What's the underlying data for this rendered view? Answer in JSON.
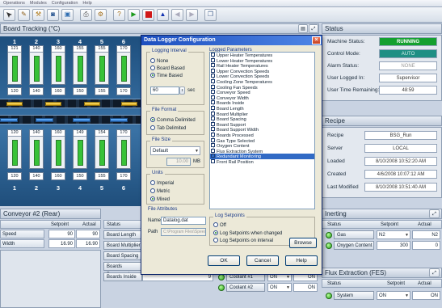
{
  "menubar": [
    "Operations",
    "Modules",
    "Configuration",
    "Help"
  ],
  "toolbar_icons": [
    "arrow-icon",
    "wrench-icon",
    "tool-icon",
    "camera-icon",
    "screen-icon",
    "printer-icon",
    "gear-icon",
    "help-icon",
    "play-icon",
    "stop-icon",
    "triangle-icon",
    "nav-icon",
    "nav2-icon",
    "window-icon"
  ],
  "board_tracking": {
    "title": "Board Tracking (°C)",
    "columns": [
      "1",
      "2",
      "3",
      "4",
      "5",
      "6",
      "1",
      "2",
      "3",
      "4",
      "5",
      "6"
    ],
    "top_setpoints": [
      "121",
      "140",
      "160",
      "155",
      "155",
      "170"
    ],
    "top_actuals": [
      "120",
      "140",
      "160",
      "150",
      "155",
      "170"
    ],
    "bottom_setpoints": [
      "120",
      "140",
      "160",
      "149",
      "154",
      "170"
    ],
    "bottom_actuals": [
      "120",
      "140",
      "160",
      "150",
      "155",
      "170"
    ]
  },
  "conveyor": {
    "title": "Conveyor #2 (Rear)",
    "col_setpoint": "Setpoint",
    "col_actual": "Actual",
    "rows": [
      {
        "label": "Speed",
        "setpoint": "90",
        "actual": "90"
      },
      {
        "label": "Width",
        "setpoint": "16.90",
        "actual": "16.90"
      }
    ]
  },
  "boards": {
    "col_status": "Status",
    "items": [
      "Board Length",
      "Board Multiplier",
      "Board Spacing",
      "Boards Processed",
      "Boards Inside"
    ],
    "boards_inside_value": "9"
  },
  "coolant": {
    "rows": [
      {
        "label": "Coolant #1",
        "mode": "ON",
        "value": "ON"
      },
      {
        "label": "Coolant #2",
        "mode": "ON",
        "value": "ON"
      }
    ]
  },
  "status": {
    "title": "Status",
    "machine_status_label": "Machine Status:",
    "machine_status": "RUNNING",
    "control_mode_label": "Control Mode:",
    "control_mode": "AUTO",
    "alarm_status_label": "Alarm Status:",
    "alarm_status": "NONE",
    "user_logged_label": "User Logged In:",
    "user_logged": "Supervisor",
    "user_time_label": "User Time Remaining:",
    "user_time": "48:59"
  },
  "recipe": {
    "title": "Recipe",
    "recipe_label": "Recipe",
    "recipe": "BSG_Run",
    "server_label": "Server",
    "server": "LOCAL",
    "loaded_label": "Loaded",
    "loaded": "8/10/2008 10:52:20 AM",
    "created_label": "Created",
    "created": "4/6/2008 10:07:12 AM",
    "modified_label": "Last Modified",
    "modified": "8/10/2008 10:51:40 AM"
  },
  "inerting": {
    "title": "Inerting",
    "col_status": "Status",
    "col_setpoint": "Setpoint",
    "col_actual": "Actual",
    "gas_label": "Gas",
    "gas_setpoint": "N2",
    "gas_actual": "N2",
    "oxygen_label": "Oxygen Content",
    "oxygen_setpoint": "300",
    "oxygen_actual": "0"
  },
  "flux": {
    "title": "Flux Extraction (FES)",
    "col_status": "Status",
    "col_setpoint": "Setpoint",
    "col_actual": "Actual",
    "system_label": "System",
    "system_setpoint": "ON",
    "system_actual": "ON"
  },
  "dialog": {
    "title": "Data Logger Configuration",
    "logging_interval": {
      "title": "Logging Interval",
      "options": [
        "None",
        "Board Based",
        "Time Based"
      ],
      "selected": 2,
      "interval_value": "60",
      "interval_unit": "sec"
    },
    "file_format": {
      "title": "File Format",
      "options": [
        "Comma Delimited",
        "Tab Delimited"
      ],
      "selected": 0
    },
    "file_size": {
      "title": "File Size",
      "mode": "Default",
      "size_value": "10.00",
      "size_unit": "MB"
    },
    "units": {
      "title": "Units",
      "options": [
        "Imperial",
        "Metric",
        "Mixed"
      ],
      "selected": 2
    },
    "logged_parameters": {
      "title": "Logged Parameters",
      "items": [
        "Upper Heater Temperatures",
        "Lower Heater Temperatures",
        "Rail Heater Temperatures",
        "Upper Convection Speeds",
        "Lower Convection Speeds",
        "Cooling Zone Temperatures",
        "Cooling Fan Speeds",
        "Conveyor Speed",
        "Conveyor Width",
        "Boards Inside",
        "Board Length",
        "Board Multiplier",
        "Board Spacing",
        "Board Support",
        "Board Support Width",
        "Boards Processed",
        "Gas Type Selected",
        "Oxygen Content",
        "Flux Extraction System",
        "Redundant Monitoring",
        "Front Rail Position"
      ],
      "checked": [
        true,
        true,
        true,
        true,
        true,
        true,
        true,
        true,
        true,
        true,
        true,
        true,
        true,
        true,
        true,
        true,
        true,
        true,
        true,
        true,
        false
      ],
      "highlighted": 19
    },
    "log_setpoints": {
      "title": "Log Setpoints",
      "options": [
        "Off",
        "Log Setpoints when changed",
        "Log Setpoints on interval"
      ],
      "selected": 1
    },
    "file_attributes": {
      "title": "File Attributes",
      "name_label": "Name",
      "name_value": "Datalog.dat",
      "path_label": "Path",
      "path_value": "C:\\Program Files\\Speedline\\Reflow\\Logs\\Data",
      "browse_label": "Browse"
    },
    "ok_label": "OK",
    "cancel_label": "Cancel",
    "help_label": "Help"
  }
}
